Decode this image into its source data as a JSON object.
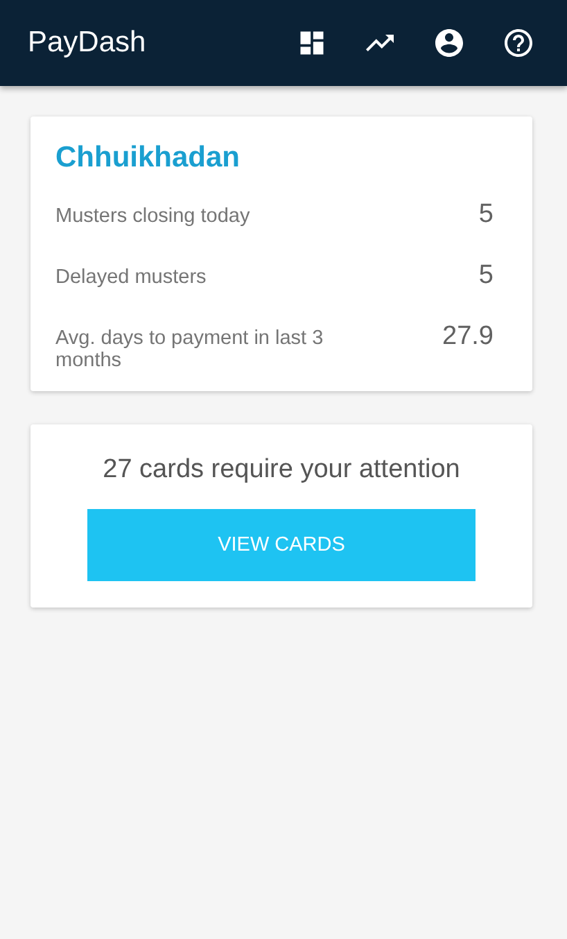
{
  "app_bar": {
    "title": "PayDash",
    "actions": [
      {
        "kind": "dashboard"
      },
      {
        "kind": "trend"
      },
      {
        "kind": "account"
      },
      {
        "kind": "help"
      }
    ]
  },
  "summary_card": {
    "title": "Chhuikhadan",
    "stats": [
      {
        "label": "Musters closing today",
        "value": "5"
      },
      {
        "label": "Delayed musters",
        "value": "5"
      },
      {
        "label": "Avg. days to payment in last 3 months",
        "value": "27.9"
      }
    ]
  },
  "attention_card": {
    "message": "27 cards require your attention",
    "button": "VIEW CARDS"
  }
}
